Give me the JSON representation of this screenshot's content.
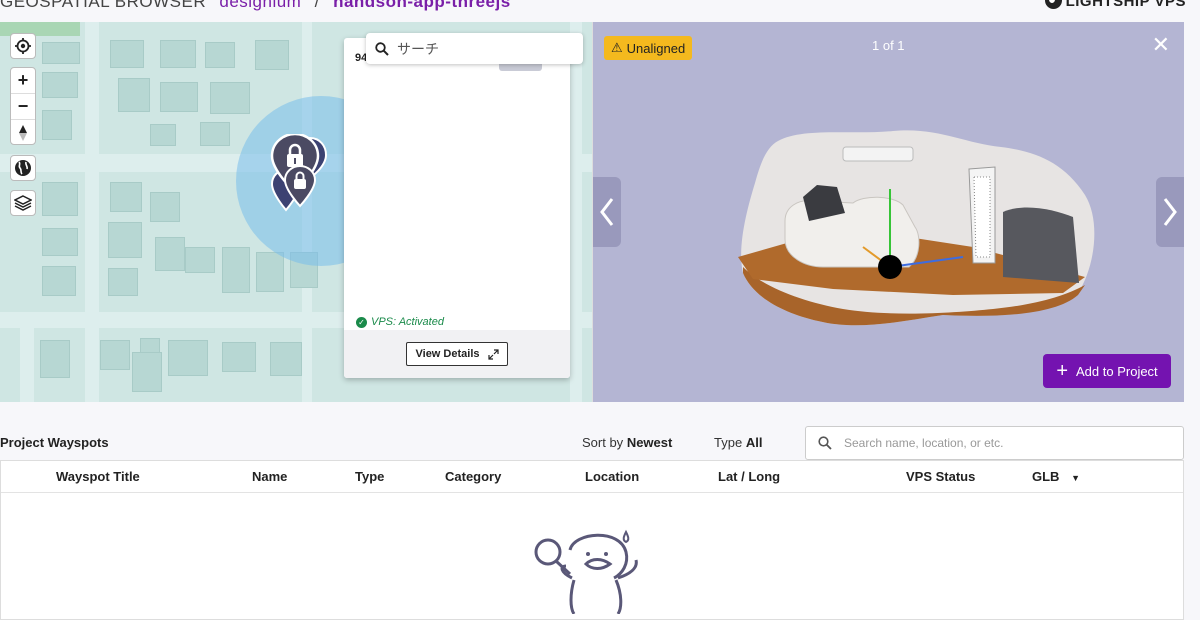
{
  "breadcrumb": {
    "root": "GEOSPATIAL BROWSER",
    "org": "designium",
    "separator": "/",
    "project": "handson-app-threejs"
  },
  "brand": {
    "name": "LIGHTSHIP",
    "suffix": "VPS",
    "icon": "globe-icon"
  },
  "map": {
    "search_placeholder": "サーチ",
    "controls": [
      "locate-icon",
      "zoom-in-icon",
      "zoom-out-icon",
      "compass-icon",
      "globe-icon",
      "layers-icon"
    ],
    "zoom_in_label": "+",
    "zoom_out_label": "−",
    "popup": {
      "id_text": "94",
      "status_text": "VPS: Activated",
      "view_details_label": "View Details"
    }
  },
  "viewer": {
    "badge": "Unaligned",
    "counter": "1 of 1",
    "add_button": "Add to Project"
  },
  "list": {
    "title": "Project Wayspots",
    "sort_prefix": "Sort by",
    "sort_value": "Newest",
    "type_prefix": "Type",
    "type_value": "All",
    "search_placeholder": "Search name, location, or etc.",
    "columns": [
      "Wayspot Title",
      "Name",
      "Type",
      "Category",
      "Location",
      "Lat / Long",
      "VPS Status",
      "GLB"
    ]
  },
  "colors": {
    "accent": "#7413b0",
    "warning": "#f4b91e",
    "success": "#1a8a4a",
    "viewer_bg": "#b4b5d3",
    "map_bg": "#cfe6e3"
  }
}
